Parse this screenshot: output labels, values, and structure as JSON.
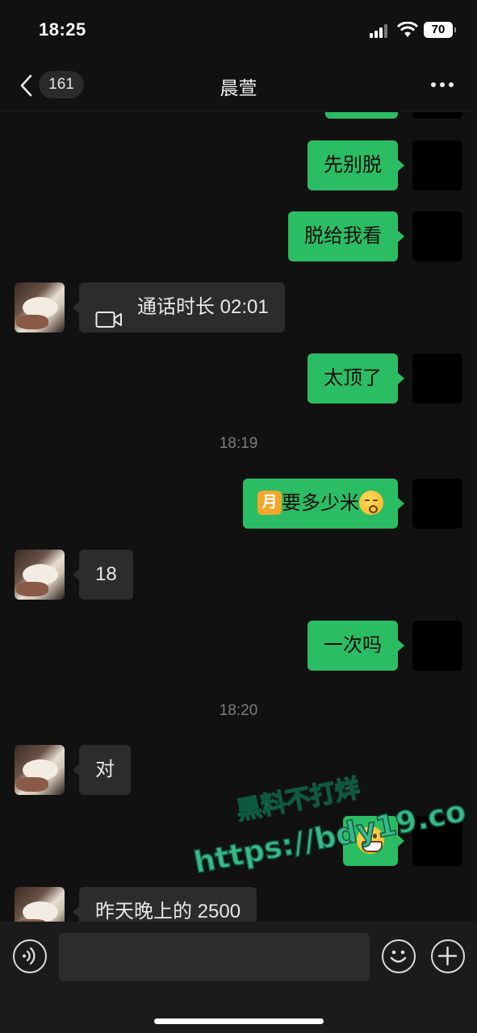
{
  "status_bar": {
    "time": "18:25",
    "battery": "70"
  },
  "nav": {
    "unread_count": "161",
    "title": "晨萱"
  },
  "messages": [
    {
      "side": "me",
      "text": "先别脱"
    },
    {
      "side": "me",
      "text": "脱给我看"
    },
    {
      "side": "them",
      "type": "video_call",
      "text": "通话时长 02:01"
    },
    {
      "side": "me",
      "text": "太顶了"
    },
    {
      "type": "timestamp",
      "text": "18:19"
    },
    {
      "side": "me",
      "prefix_emoji": "🈷️",
      "text": "要多少米",
      "suffix_emoji": "😚"
    },
    {
      "side": "them",
      "text": "18"
    },
    {
      "side": "me",
      "text": "一次吗"
    },
    {
      "type": "timestamp",
      "text": "18:20"
    },
    {
      "side": "them",
      "text": "对"
    },
    {
      "side": "me",
      "emoji": "😁"
    },
    {
      "side": "them",
      "text": "昨天晚上的 2500"
    }
  ],
  "watermark": {
    "line1": "黑料不打烊",
    "line2": "https://bdy19.co"
  },
  "colors": {
    "my_bubble": "#2bbd63",
    "their_bubble": "#2c2c2c",
    "background": "#111111"
  },
  "icons": [
    "back-chevron-icon",
    "more-icon",
    "video-call-icon",
    "voice-icon",
    "emoji-icon",
    "plus-icon"
  ]
}
